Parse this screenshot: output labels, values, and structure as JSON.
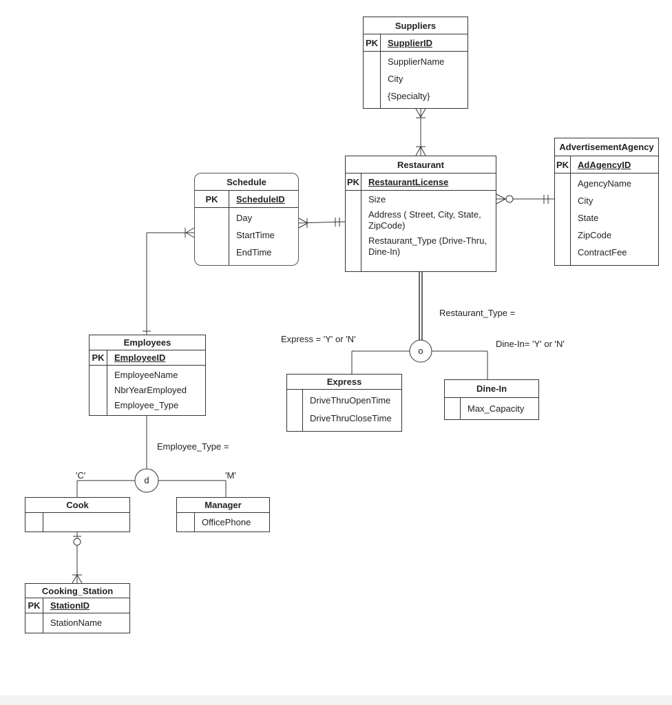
{
  "entities": [
    {
      "id": "suppliers",
      "title": "Suppliers",
      "pk_label": "PK",
      "pk": "SupplierID",
      "attributes": [
        "SupplierName",
        "City",
        "{Specialty}"
      ]
    },
    {
      "id": "restaurant",
      "title": "Restaurant",
      "pk_label": "PK",
      "pk": "RestaurantLicense",
      "attributes": [
        "Size",
        "Address ( Street, City, State, ZipCode)",
        "Restaurant_Type (Drive-Thru, Dine-In)"
      ]
    },
    {
      "id": "schedule",
      "title": "Schedule",
      "pk_label": "PK",
      "pk": "ScheduleID",
      "attributes": [
        "Day",
        "StartTime",
        "EndTime"
      ]
    },
    {
      "id": "adagency",
      "title": "AdvertisementAgency",
      "pk_label": "PK",
      "pk": "AdAgencyID",
      "attributes": [
        "AgencyName",
        "City",
        "State",
        "ZipCode",
        "ContractFee"
      ]
    },
    {
      "id": "employees",
      "title": "Employees",
      "pk_label": "PK",
      "pk": "EmployeeID",
      "attributes": [
        "EmployeeName",
        "NbrYearEmployed",
        "Employee_Type"
      ]
    },
    {
      "id": "express",
      "title": "Express",
      "attributes": [
        "DriveThruOpenTime",
        "DriveThruCloseTime"
      ]
    },
    {
      "id": "dinein",
      "title": "Dine-In",
      "attributes": [
        "Max_Capacity"
      ]
    },
    {
      "id": "cook",
      "title": "Cook",
      "attributes": []
    },
    {
      "id": "manager",
      "title": "Manager",
      "attributes": [
        "OfficePhone"
      ]
    },
    {
      "id": "cooking_station",
      "title": "Cooking_Station",
      "pk_label": "PK",
      "pk": "StationID",
      "attributes": [
        "StationName"
      ]
    }
  ],
  "relationships": [
    {
      "from": "suppliers",
      "to": "restaurant",
      "from_cardinality": "one-or-many",
      "to_cardinality": "one-or-many"
    },
    {
      "from": "schedule",
      "to": "restaurant",
      "from_cardinality": "one-or-many",
      "to_cardinality": "one-and-only-one"
    },
    {
      "from": "restaurant",
      "to": "adagency",
      "from_cardinality": "zero-or-many",
      "to_cardinality": "one-and-only-one"
    },
    {
      "from": "schedule",
      "to": "employees",
      "from_cardinality": "one-or-many",
      "to_cardinality": "one-and-only-one"
    },
    {
      "from": "cook",
      "to": "cooking_station",
      "from_cardinality": "zero-or-one",
      "to_cardinality": "one-or-many"
    }
  ],
  "specializations": [
    {
      "id": "restaurant_spec",
      "parent": "restaurant",
      "symbol": "o",
      "participation": "total",
      "discriminator": "Restaurant_Type =",
      "children": [
        {
          "entity": "express",
          "label": "Express = 'Y' or 'N'"
        },
        {
          "entity": "dinein",
          "label": "Dine-In= 'Y' or 'N'"
        }
      ]
    },
    {
      "id": "employee_spec",
      "parent": "employees",
      "symbol": "d",
      "participation": "partial",
      "discriminator": "Employee_Type =",
      "children": [
        {
          "entity": "cook",
          "label": "'C'"
        },
        {
          "entity": "manager",
          "label": "'M'"
        }
      ]
    }
  ],
  "colors": {
    "line": "#333333",
    "background": "#ffffff"
  }
}
